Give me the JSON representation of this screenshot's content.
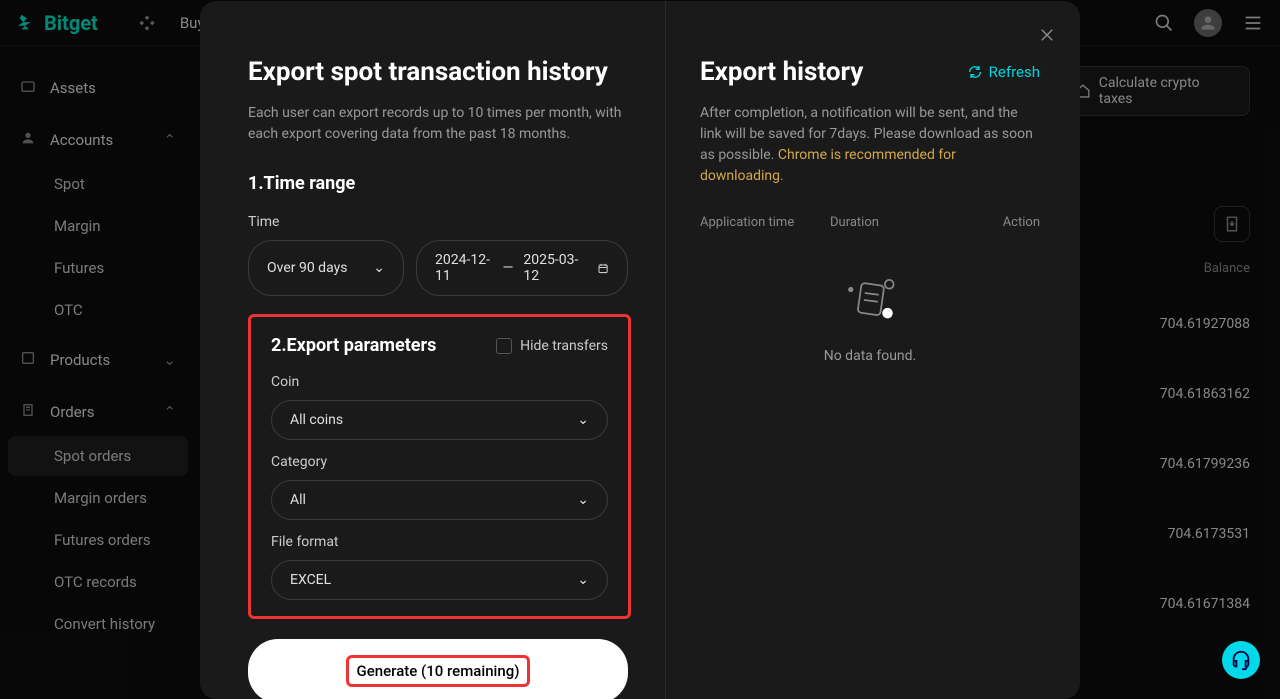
{
  "brand": "Bitget",
  "topnav": {
    "buy": "Buy"
  },
  "topbar": {
    "calc_taxes": "Calculate crypto taxes",
    "balance_label": "Balance"
  },
  "balances": [
    "704.61927088",
    "704.61863162",
    "704.61799236",
    "704.6173531",
    "704.61671384"
  ],
  "sidebar": {
    "assets": "Assets",
    "accounts": {
      "label": "Accounts",
      "items": [
        "Spot",
        "Margin",
        "Futures",
        "OTC"
      ]
    },
    "products": "Products",
    "orders": {
      "label": "Orders",
      "items": [
        "Spot orders",
        "Margin orders",
        "Futures orders",
        "OTC records",
        "Convert history"
      ]
    }
  },
  "modal": {
    "left": {
      "title": "Export spot transaction history",
      "desc": "Each user can export records up to 10 times per month, with each export covering data from the past 18 months.",
      "step1": "1.Time range",
      "time_label": "Time",
      "time_preset": "Over 90 days",
      "date_from": "2024-12-11",
      "date_sep": "—",
      "date_to": "2025-03-12",
      "step2": "2.Export parameters",
      "hide_transfers": "Hide transfers",
      "coin_label": "Coin",
      "coin_value": "All coins",
      "category_label": "Category",
      "category_value": "All",
      "format_label": "File format",
      "format_value": "EXCEL",
      "generate": "Generate (10 remaining)"
    },
    "right": {
      "title": "Export history",
      "refresh": "Refresh",
      "desc1": "After completion, a notification will be sent, and the link will be saved for 7days. Please download as soon as possible. ",
      "desc2": "Chrome is recommended for downloading",
      "col1": "Application time",
      "col2": "Duration",
      "col3": "Action",
      "empty": "No data found."
    }
  }
}
